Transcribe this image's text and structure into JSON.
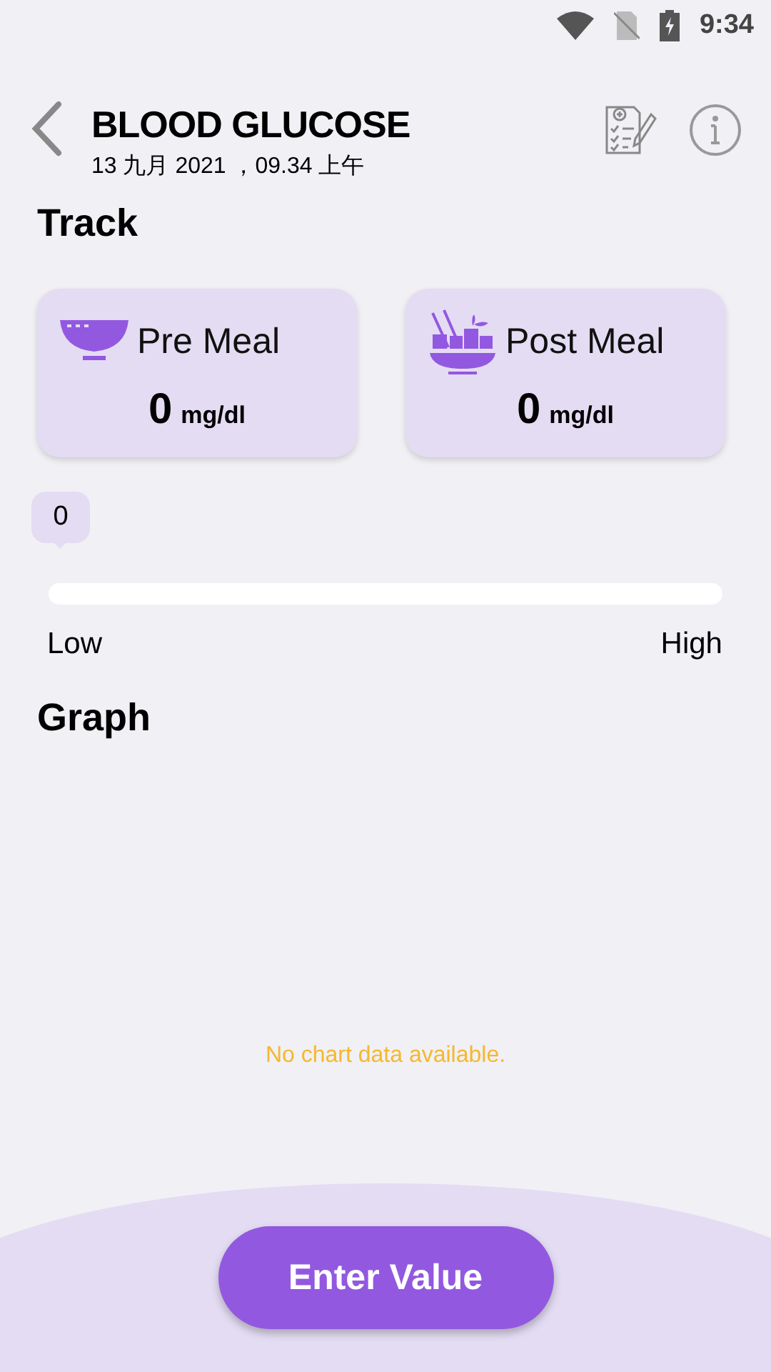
{
  "status_bar": {
    "time": "9:34"
  },
  "header": {
    "title": "BLOOD GLUCOSE",
    "subtitle": "13 九月 2021 ，09.34 上午"
  },
  "track": {
    "heading": "Track",
    "cards": [
      {
        "kind": "pre",
        "label": "Pre Meal",
        "value": "0",
        "unit": "mg/dl"
      },
      {
        "kind": "post",
        "label": "Post Meal",
        "value": "0",
        "unit": "mg/dl"
      }
    ]
  },
  "slider": {
    "bubble": "0",
    "level": 0,
    "low_label": "Low",
    "high_label": "High"
  },
  "graph": {
    "heading": "Graph",
    "empty_message": "No chart data available."
  },
  "button": {
    "label": "Enter Value"
  }
}
